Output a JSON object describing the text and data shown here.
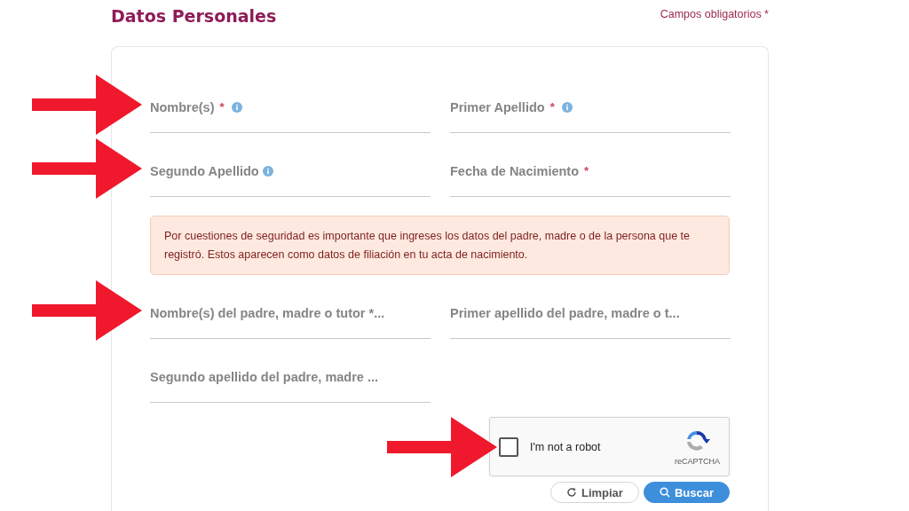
{
  "header": {
    "title": "Datos Personales",
    "required_note": "Campos obligatorios *"
  },
  "required_mark": "*",
  "fields": [
    {
      "label": "Nombre(s)",
      "required": true,
      "info": true,
      "marked": true
    },
    {
      "label": "Primer Apellido",
      "required": true,
      "info": true,
      "marked": false
    },
    {
      "label": "Segundo Apellido",
      "required": false,
      "info": true,
      "marked": true
    },
    {
      "label": "Fecha de Nacimiento",
      "required": true,
      "info": false,
      "marked": false
    }
  ],
  "alert": "Por cuestiones de seguridad es importante que ingreses los datos del padre, madre o de la persona que te registró. Estos aparecen como datos de filiación en tu acta de nacimiento.",
  "parent_fields": [
    {
      "label": "Nombre(s) del padre, madre o tutor *...",
      "marked": true
    },
    {
      "label": "Primer apellido del padre, madre o t...",
      "marked": false
    },
    {
      "label": "Segundo apellido del padre, madre ...",
      "marked": false
    }
  ],
  "captcha": {
    "label": "I'm not a robot",
    "brand": "reCAPTCHA",
    "checked": false,
    "marked": true
  },
  "buttons": [
    {
      "label": "Limpiar",
      "kind": "secondary"
    },
    {
      "label": "Buscar",
      "kind": "primary"
    }
  ]
}
